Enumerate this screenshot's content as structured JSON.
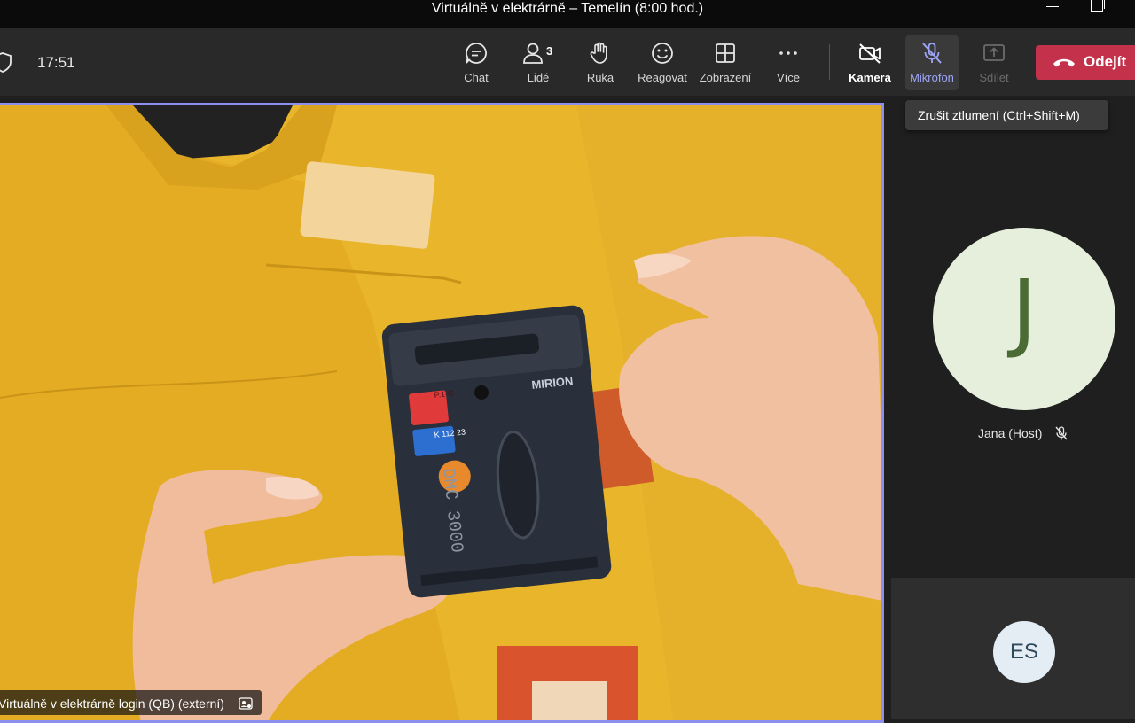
{
  "window": {
    "title": "Virtuálně v elektrárně – Temelín (8:00 hod.)"
  },
  "toolbar": {
    "timer": "17:51",
    "chat_label": "Chat",
    "people_label": "Lidé",
    "people_count": "3",
    "hand_label": "Ruka",
    "react_label": "Reagovat",
    "view_label": "Zobrazení",
    "more_label": "Více",
    "camera_label": "Kamera",
    "mic_label": "Mikrofon",
    "share_label": "Sdílet",
    "leave_label": "Odejít"
  },
  "tooltip": {
    "text": "Zrušit ztlumení (Ctrl+Shift+M)"
  },
  "main_video": {
    "label": "Virtuálně v elektrárně login (QB) (externí)",
    "device_brand": "MIRION",
    "device_model": "DMC 3000",
    "tag_red": "P.1-G",
    "tag_blue": "K 112 23"
  },
  "participants": [
    {
      "initial": "J",
      "name": "Jana (Host)"
    },
    {
      "initials": "ES"
    }
  ],
  "colors": {
    "accent": "#8b8ff0",
    "leave": "#c4314b",
    "avatar_j_bg": "#e6eedc",
    "avatar_j_fg": "#4a6b34",
    "avatar_es_bg": "#e4edf4"
  }
}
